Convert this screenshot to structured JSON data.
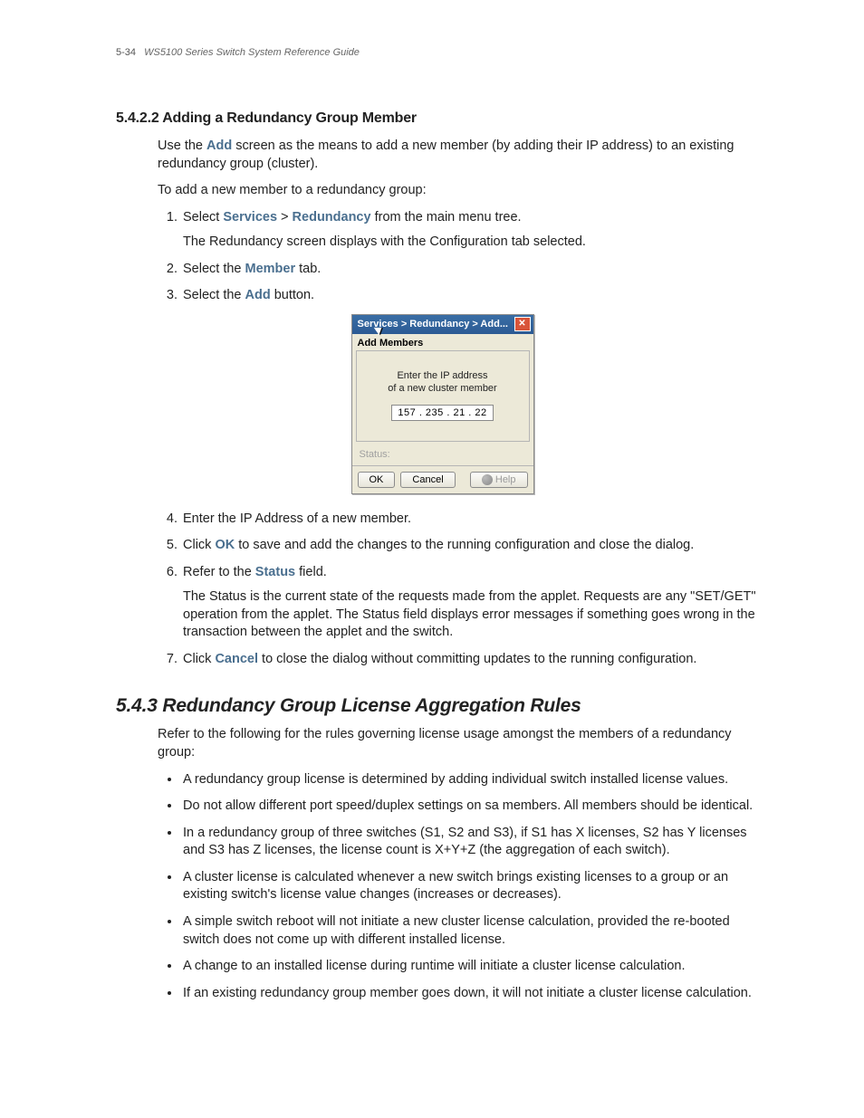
{
  "header": {
    "page_number": "5-34",
    "doc_title": "WS5100 Series Switch System Reference Guide"
  },
  "section_5422": {
    "number": "5.4.2.2",
    "title": "Adding a Redundancy Group Member",
    "intro_prefix": "Use the ",
    "intro_kw1": "Add",
    "intro_suffix": " screen as the means to add a new member (by adding their IP address) to an existing redundancy group (cluster).",
    "lead": "To add a new member to a redundancy group:",
    "step1_a": "Select ",
    "step1_kw_services": "Services",
    "step1_gt": " > ",
    "step1_kw_redundancy": "Redundancy",
    "step1_b": " from the main menu tree.",
    "step1_detail": "The Redundancy screen displays with the Configuration tab selected.",
    "step2_a": "Select the ",
    "step2_kw": "Member",
    "step2_b": " tab.",
    "step3_a": "Select the ",
    "step3_kw": "Add",
    "step3_b": " button.",
    "step4": "Enter the IP Address of a new member.",
    "step5_a": "Click ",
    "step5_kw": "OK",
    "step5_b": " to save and add the changes to the running configuration and close the dialog.",
    "step6_a": "Refer to the ",
    "step6_kw": "Status",
    "step6_b": " field.",
    "step6_detail": "The Status is the current state of the requests made from the applet. Requests are any \"SET/GET\" operation from the applet. The Status field displays error messages if something goes wrong in the transaction between the applet and the switch.",
    "step7_a": "Click ",
    "step7_kw": "Cancel",
    "step7_b": " to close the dialog without committing updates to the running configuration."
  },
  "dialog": {
    "title": "Services > Redundancy > Add...",
    "section_label": "Add Members",
    "hint_line1": "Enter the IP address",
    "hint_line2": "of a new cluster member",
    "ip_value": "157 . 235 . 21  . 22",
    "status_label": "Status:",
    "ok": "OK",
    "cancel": "Cancel",
    "help": "Help"
  },
  "section_543": {
    "number": "5.4.3",
    "title": "Redundancy Group License Aggregation Rules",
    "intro": "Refer to the following for the rules governing license usage amongst the members of a redundancy group:",
    "bullets": [
      "A redundancy group license is determined by adding individual switch installed license values.",
      "Do not allow different port speed/duplex settings on sa members. All members should be identical.",
      "In a redundancy group of three switches (S1, S2 and S3), if S1 has X licenses, S2 has Y licenses and S3 has Z licenses, the license count is X+Y+Z (the aggregation of each switch).",
      "A cluster license is calculated whenever a new switch brings existing licenses to a group or an existing switch's license value changes (increases or decreases).",
      "A simple switch reboot will not initiate a new cluster license calculation, provided the re-booted switch does not come up with different installed license.",
      "A change to an installed license during runtime will initiate a cluster license calculation.",
      "If an existing redundancy group member goes down, it will not initiate a cluster license calculation."
    ]
  }
}
